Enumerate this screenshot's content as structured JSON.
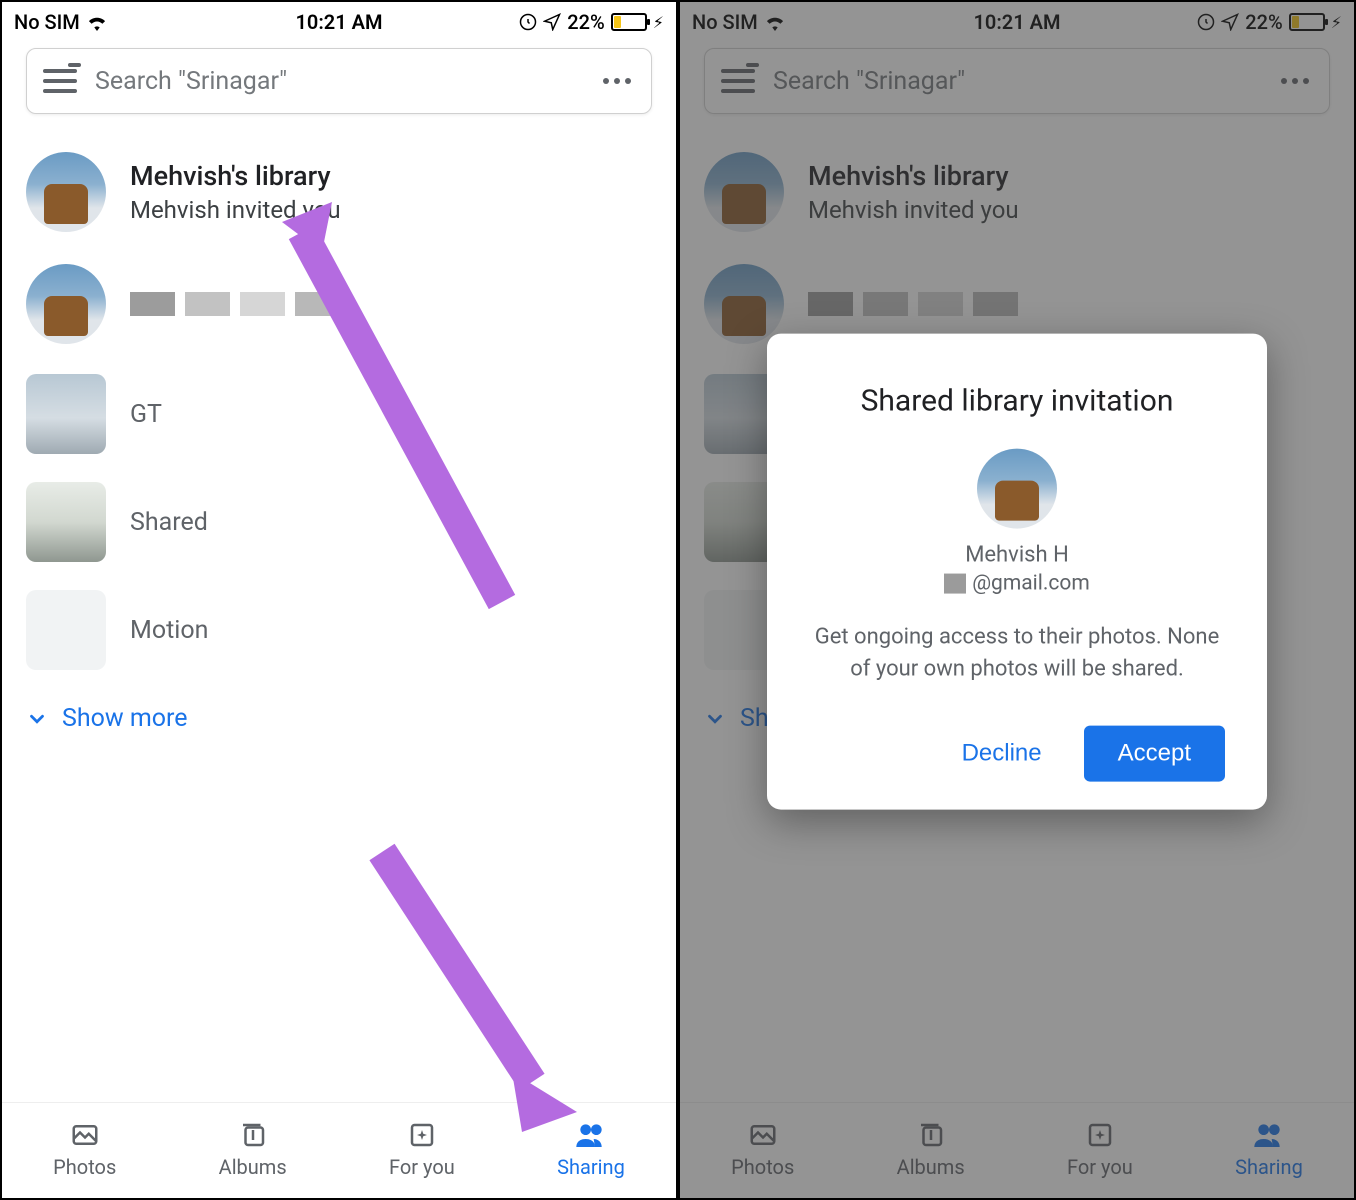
{
  "status": {
    "no_sim": "No SIM",
    "time": "10:21 AM",
    "battery_percent": "22%"
  },
  "search": {
    "placeholder": "Search \"Srinagar\""
  },
  "library": {
    "title": "Mehvish's library",
    "subtitle": "Mehvish invited you"
  },
  "albums": [
    {
      "label": "GT"
    },
    {
      "label": "Shared"
    },
    {
      "label": "Motion"
    }
  ],
  "show_more": "Show more",
  "nav": {
    "photos": "Photos",
    "albums": "Albums",
    "for_you": "For you",
    "sharing": "Sharing"
  },
  "dialog": {
    "title": "Shared library invitation",
    "name": "Mehvish H",
    "email_suffix": "@gmail.com",
    "body": "Get ongoing access to their photos. None of your own photos will be shared.",
    "decline": "Decline",
    "accept": "Accept"
  }
}
